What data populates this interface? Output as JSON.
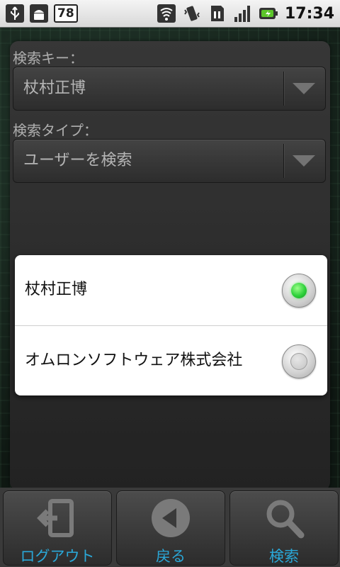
{
  "status_bar": {
    "icons_left": [
      "usb-icon",
      "android-debug-icon"
    ],
    "battery_level": "78",
    "icons_right": [
      "wifi-icon",
      "vibrate-icon",
      "sim-card-icon",
      "signal-icon",
      "charging-battery-icon"
    ],
    "time": "17:34"
  },
  "form": {
    "search_key_label": "検索キー：",
    "search_key_value": "杖村正博",
    "search_type_label": "検索タイプ：",
    "search_type_value": "ユーザーを検索"
  },
  "dialog": {
    "options": [
      {
        "label": "杖村正博",
        "selected": true
      },
      {
        "label": "オムロンソフトウェア株式会社",
        "selected": false
      }
    ]
  },
  "toolbar": {
    "logout_label": "ログアウト",
    "back_label": "戻る",
    "search_label": "検索"
  },
  "colors": {
    "toolbar_label": "#2aa8d8",
    "radio_selected": "#2ed13a"
  }
}
